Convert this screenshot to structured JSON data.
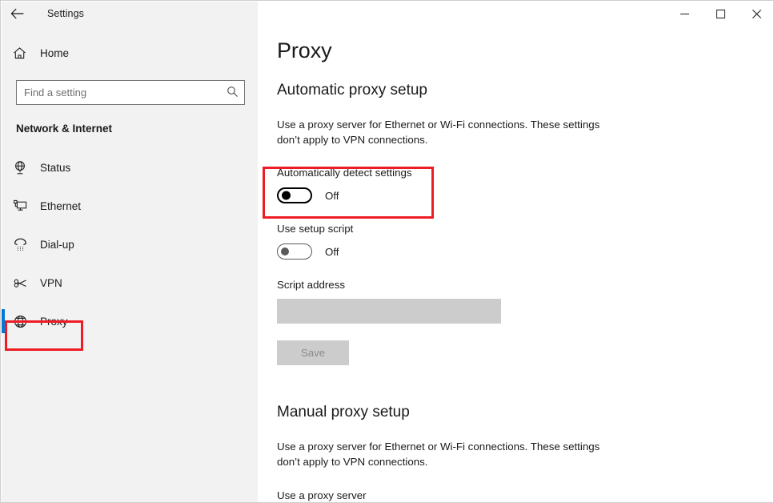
{
  "window": {
    "title": "Settings",
    "back_icon": "back-arrow-icon",
    "controls": {
      "minimize": "minimize-icon",
      "maximize": "maximize-icon",
      "close": "close-icon"
    }
  },
  "sidebar": {
    "home": {
      "label": "Home",
      "icon": "home-icon"
    },
    "search": {
      "value": "",
      "placeholder": "Find a setting",
      "icon": "search-icon"
    },
    "category": "Network & Internet",
    "items": [
      {
        "label": "Status",
        "icon": "globe-stand-icon",
        "selected": false
      },
      {
        "label": "Ethernet",
        "icon": "monitor-icon",
        "selected": false
      },
      {
        "label": "Dial-up",
        "icon": "telephone-icon",
        "selected": false
      },
      {
        "label": "VPN",
        "icon": "vpn-key-icon",
        "selected": false
      },
      {
        "label": "Proxy",
        "icon": "globe-icon",
        "selected": true
      }
    ]
  },
  "main": {
    "page_title": "Proxy",
    "automatic": {
      "heading": "Automatic proxy setup",
      "description": "Use a proxy server for Ethernet or Wi-Fi connections. These settings don’t apply to VPN connections.",
      "auto_detect": {
        "label": "Automatically detect settings",
        "state": "Off"
      },
      "setup_script": {
        "label": "Use setup script",
        "state": "Off"
      },
      "script_address": {
        "label": "Script address",
        "value": "",
        "placeholder": ""
      },
      "save_label": "Save"
    },
    "manual": {
      "heading": "Manual proxy setup",
      "description": "Use a proxy server for Ethernet or Wi-Fi connections. These settings don’t apply to VPN connections.",
      "use_proxy_label": "Use a proxy server"
    }
  },
  "annotations": {
    "color": "#ee1c25",
    "boxes": [
      {
        "name": "proxy-nav-highlight"
      },
      {
        "name": "automatically-detect-settings-highlight"
      }
    ]
  }
}
